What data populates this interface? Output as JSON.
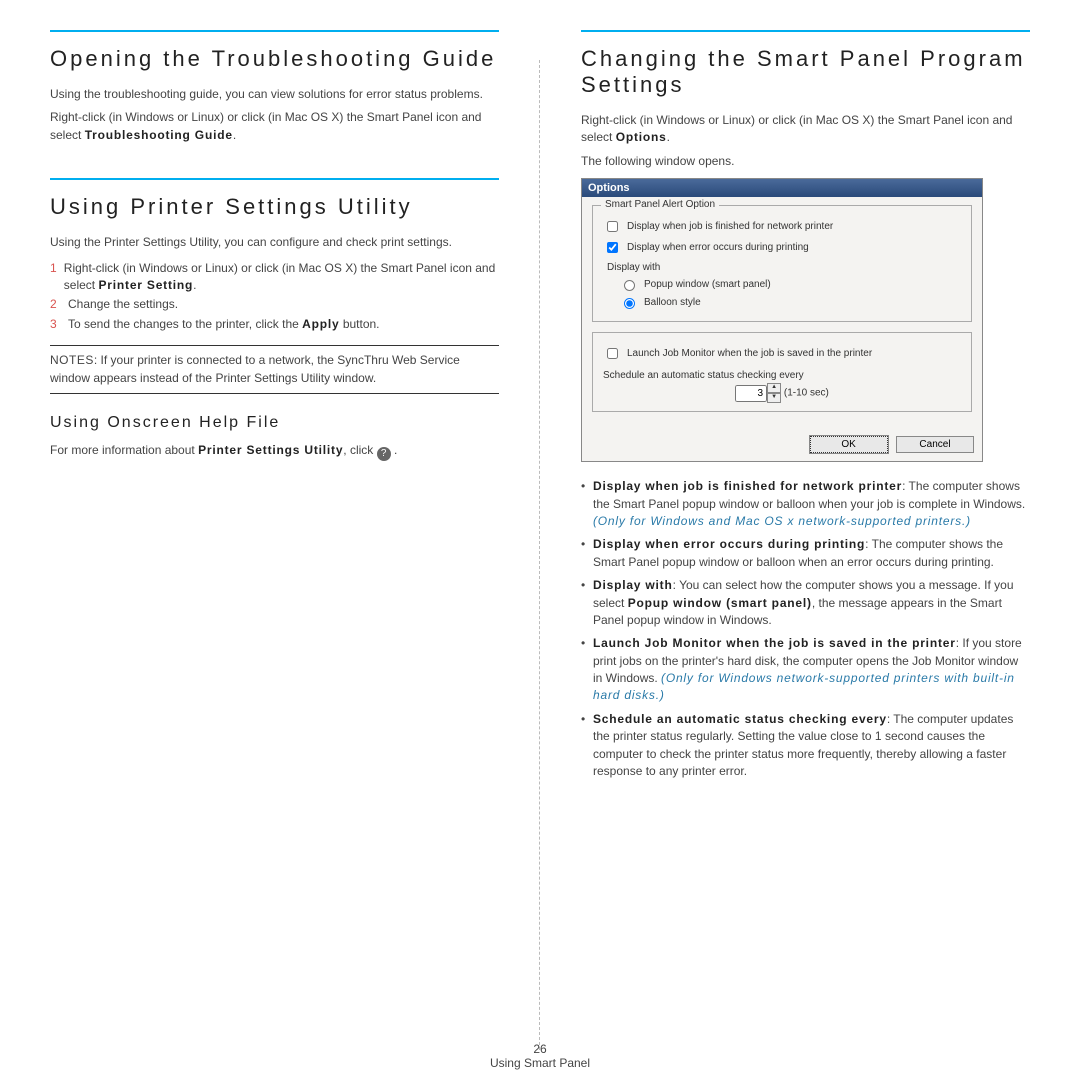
{
  "left": {
    "sec1": {
      "title": "Opening the Troubleshooting Guide",
      "p1": "Using the troubleshooting guide, you can view solutions for error status problems.",
      "p2_a": "Right-click (in Windows or Linux) or click (in Mac OS X) the Smart Panel icon and select ",
      "p2_b": "Troubleshooting Guide",
      "p2_c": "."
    },
    "sec2": {
      "title": "Using Printer Settings Utility",
      "p1": "Using the Printer Settings Utility, you can configure and check print settings.",
      "steps": {
        "s1a": "Right-click (in Windows or Linux) or click (in Mac OS X) the Smart Panel icon and select ",
        "s1b": "Printer Setting",
        "s1c": ".",
        "s2": "Change the settings.",
        "s3a": "To send the changes to the printer, click the ",
        "s3b": "Apply",
        "s3c": " button."
      },
      "note_label": "NOTES",
      "note_text": ": If your printer is connected to a network, the SyncThru Web Service window appears instead of the Printer Settings Utility window."
    },
    "sec3": {
      "title": "Using Onscreen Help File",
      "p_a": "For more information about ",
      "p_b": "Printer Settings Utility",
      "p_c": ", click "
    }
  },
  "right": {
    "title": "Changing the Smart Panel Program Settings",
    "p1_a": "Right-click (in Windows or Linux) or click (in Mac OS X) the Smart Panel icon and select ",
    "p1_b": "Options",
    "p1_c": ".",
    "p2": "The following window opens.",
    "dialog": {
      "title": "Options",
      "legend": "Smart Panel Alert Option",
      "cb1": "Display when job is finished for network printer",
      "cb2": "Display when error occurs during printing",
      "displaywith": "Display with",
      "r1": "Popup window (smart panel)",
      "r2": "Balloon style",
      "cb3": "Launch Job Monitor when the job is saved in the printer",
      "sched": "Schedule an automatic status checking every",
      "spin": "3",
      "range": "(1-10 sec)",
      "ok": "OK",
      "cancel": "Cancel"
    },
    "bullets": {
      "b1_t": "Display when job is finished for network printer",
      "b1_r": ": The computer shows the Smart Panel popup window or balloon when your job is complete in Windows. ",
      "b1_i": "(Only for Windows and Mac OS x network-supported printers.)",
      "b2_t": "Display when error occurs during printing",
      "b2_r": ": The computer shows the Smart Panel popup window or balloon when an error occurs during printing.",
      "b3_t": "Display with",
      "b3_ra": ": You can select how the computer shows you a message. If you select ",
      "b3_rb": "Popup window (smart panel)",
      "b3_rc": ", the message appears in the Smart Panel popup window in Windows.",
      "b4_t": "Launch Job Monitor when the job is saved in the printer",
      "b4_r": ": If you store print jobs on the printer's hard disk, the computer opens the Job Monitor window in Windows. ",
      "b4_i": "(Only for Windows network-supported printers with built-in hard disks.)",
      "b5_t": "Schedule an automatic status checking every",
      "b5_r": ": The computer updates the printer status regularly. Setting the value close to 1 second causes the computer to check the printer status more frequently, thereby allowing a faster response to any printer error."
    }
  },
  "footer": {
    "page": "26",
    "section": "Using Smart Panel"
  }
}
